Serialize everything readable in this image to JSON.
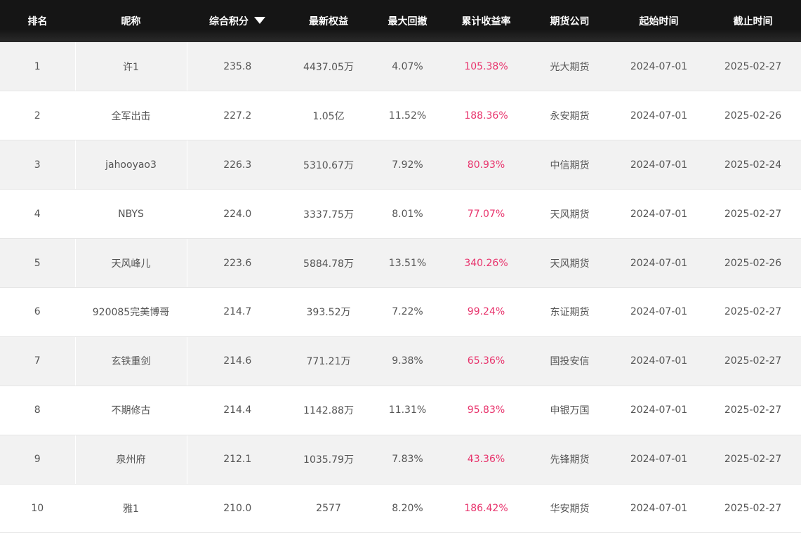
{
  "headers": {
    "rank": "排名",
    "nickname": "昵称",
    "score": "综合积分",
    "equity": "最新权益",
    "drawdown": "最大回撤",
    "return": "累计收益率",
    "company": "期货公司",
    "start": "起始时间",
    "end": "截止时间"
  },
  "sort": {
    "column": "score",
    "direction": "desc",
    "icon": "sort-down-triangle-icon"
  },
  "colors": {
    "header_bg": "#151515",
    "row_alt": "#f2f2f2",
    "return_text": "#e8336c",
    "body_text": "#555555"
  },
  "rows": [
    {
      "rank": "1",
      "nickname": "许1",
      "score": "235.8",
      "equity": "4437.05万",
      "drawdown": "4.07%",
      "return": "105.38%",
      "company": "光大期货",
      "start": "2024-07-01",
      "end": "2025-02-27"
    },
    {
      "rank": "2",
      "nickname": "全军出击",
      "score": "227.2",
      "equity": "1.05亿",
      "drawdown": "11.52%",
      "return": "188.36%",
      "company": "永安期货",
      "start": "2024-07-01",
      "end": "2025-02-26"
    },
    {
      "rank": "3",
      "nickname": "jahooyao3",
      "score": "226.3",
      "equity": "5310.67万",
      "drawdown": "7.92%",
      "return": "80.93%",
      "company": "中信期货",
      "start": "2024-07-01",
      "end": "2025-02-24"
    },
    {
      "rank": "4",
      "nickname": "NBYS",
      "score": "224.0",
      "equity": "3337.75万",
      "drawdown": "8.01%",
      "return": "77.07%",
      "company": "天风期货",
      "start": "2024-07-01",
      "end": "2025-02-27"
    },
    {
      "rank": "5",
      "nickname": "天风峰儿",
      "score": "223.6",
      "equity": "5884.78万",
      "drawdown": "13.51%",
      "return": "340.26%",
      "company": "天风期货",
      "start": "2024-07-01",
      "end": "2025-02-26"
    },
    {
      "rank": "6",
      "nickname": "920085完美博哥",
      "score": "214.7",
      "equity": "393.52万",
      "drawdown": "7.22%",
      "return": "99.24%",
      "company": "东证期货",
      "start": "2024-07-01",
      "end": "2025-02-27"
    },
    {
      "rank": "7",
      "nickname": "玄铁重剑",
      "score": "214.6",
      "equity": "771.21万",
      "drawdown": "9.38%",
      "return": "65.36%",
      "company": "国投安信",
      "start": "2024-07-01",
      "end": "2025-02-27"
    },
    {
      "rank": "8",
      "nickname": "不期修古",
      "score": "214.4",
      "equity": "1142.88万",
      "drawdown": "11.31%",
      "return": "95.83%",
      "company": "申银万国",
      "start": "2024-07-01",
      "end": "2025-02-27"
    },
    {
      "rank": "9",
      "nickname": "泉州府",
      "score": "212.1",
      "equity": "1035.79万",
      "drawdown": "7.83%",
      "return": "43.36%",
      "company": "先锋期货",
      "start": "2024-07-01",
      "end": "2025-02-27"
    },
    {
      "rank": "10",
      "nickname": "雅1",
      "score": "210.0",
      "equity": "2577",
      "drawdown": "8.20%",
      "return": "186.42%",
      "company": "华安期货",
      "start": "2024-07-01",
      "end": "2025-02-27"
    }
  ]
}
